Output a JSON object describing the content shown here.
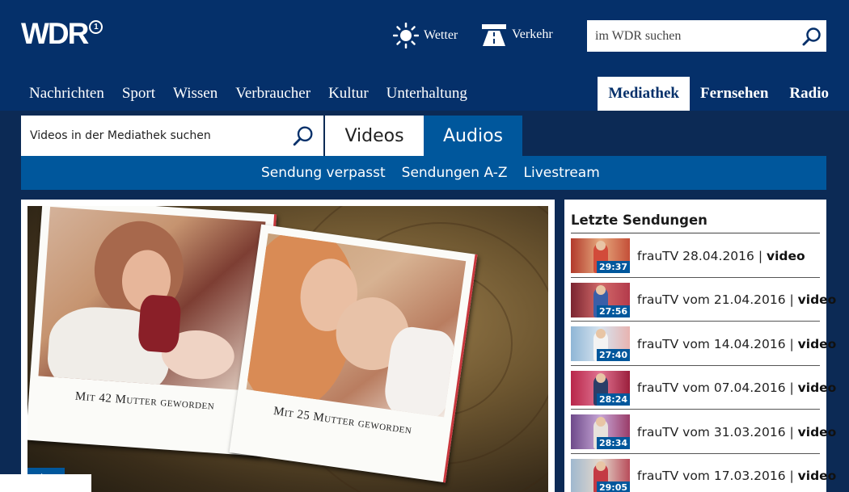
{
  "header": {
    "logo_text": "WDR",
    "logo_badge": "1",
    "services": [
      {
        "label": "Wetter",
        "icon": "sun-icon"
      },
      {
        "label": "Verkehr",
        "icon": "road-icon"
      }
    ],
    "search_placeholder": "im WDR suchen"
  },
  "nav": {
    "main": [
      "Nachrichten",
      "Sport",
      "Wissen",
      "Verbraucher",
      "Kultur",
      "Unterhaltung"
    ],
    "right": [
      "Mediathek",
      "Fernsehen",
      "Radio"
    ],
    "active": "Mediathek"
  },
  "mediathek": {
    "search_placeholder": "Videos in der Mediathek suchen",
    "tabs": [
      "Videos",
      "Audios"
    ],
    "subnav": [
      "Sendung verpasst",
      "Sendungen A-Z",
      "Livestream"
    ]
  },
  "hero": {
    "caption_1": "Mit 42 Mutter geworden",
    "caption_2": "Mit 25 Mutter geworden"
  },
  "sidebar": {
    "title": "Letzte Sendungen",
    "items": [
      {
        "title": "frauTV 28.04.2016 | ",
        "type": "video",
        "duration": "29:37"
      },
      {
        "title": "frauTV vom 21.04.2016 | ",
        "type": "video",
        "duration": "27:56"
      },
      {
        "title": "frauTV vom 14.04.2016 | ",
        "type": "video",
        "duration": "27:40"
      },
      {
        "title": "frauTV vom 07.04.2016 | ",
        "type": "video",
        "duration": "28:24"
      },
      {
        "title": "frauTV vom 31.03.2016 | ",
        "type": "video",
        "duration": "28:34"
      },
      {
        "title": "frauTV vom 17.03.2016 | ",
        "type": "video",
        "duration": "29:05"
      }
    ]
  },
  "colors": {
    "header_bg": "#05306a",
    "accent_blue": "#00579c",
    "band_bg": "#0c2a55"
  }
}
